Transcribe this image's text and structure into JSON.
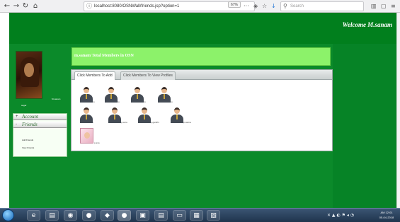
{
  "browser": {
    "url": "localhost:8080/OSNWall/friends.jsp?option=1",
    "zoom": "67%",
    "search_placeholder": "Search"
  },
  "header": {
    "welcome": "Welcome M.sanam"
  },
  "profile": {
    "name": "M.sanam",
    "caption": "sagar"
  },
  "sidebar": {
    "sections": [
      {
        "toggle": "+",
        "label": "Account"
      },
      {
        "toggle": "-",
        "label": "Friends"
      }
    ],
    "links": [
      "Add Friends",
      "View Friends"
    ]
  },
  "main": {
    "stats_title": "m.sanam Total Members in OSN",
    "tabs": [
      {
        "label": "Click Members To Add",
        "active": true
      },
      {
        "label": "Click Members To View Profiles",
        "active": false
      }
    ],
    "members": [
      {
        "label": "ru"
      },
      {
        "label": "ru"
      },
      {
        "label": "ru"
      },
      {
        "label": "ru"
      },
      {
        "label": "r"
      },
      {
        "label": "p.sonu"
      },
      {
        "label": "p.gandhi"
      },
      {
        "label": "p.varma"
      },
      {
        "label": "p.ana"
      }
    ]
  },
  "taskbar": {
    "time": "AM 12:01",
    "date": "05-04-2018"
  }
}
